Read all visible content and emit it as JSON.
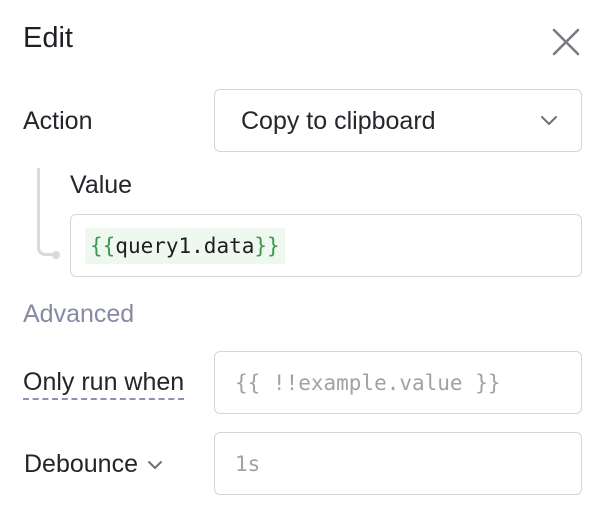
{
  "panel": {
    "title": "Edit"
  },
  "action": {
    "label": "Action",
    "selected": "Copy to clipboard"
  },
  "value": {
    "label": "Value",
    "code_open": "{{",
    "code_expr": "query1.data",
    "code_close": "}}"
  },
  "advanced": {
    "heading": "Advanced",
    "only_run_when": {
      "label": "Only run when",
      "placeholder": "{{ !!example.value }}"
    },
    "debounce": {
      "label": "Debounce",
      "placeholder": "1s"
    }
  },
  "colors": {
    "accent_brace": "#3a9a54",
    "chip_bg": "#eef8ee",
    "muted_heading": "#878aa3",
    "border": "#d4d4da"
  },
  "icons": [
    "close-icon",
    "chevron-down-icon"
  ]
}
